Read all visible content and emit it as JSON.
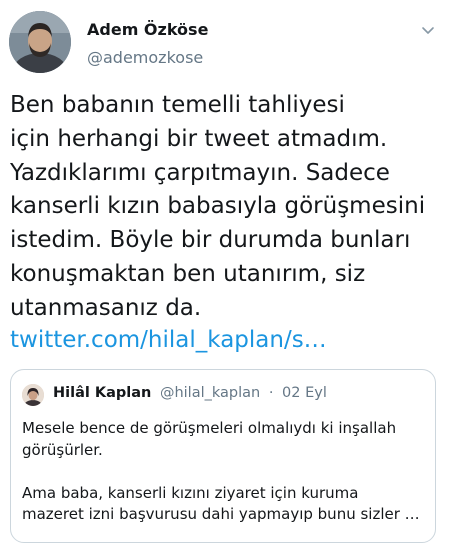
{
  "author": {
    "name": "Adem Özköse",
    "handle": "@ademozkose"
  },
  "icons": {
    "avatar": "person-avatar",
    "menu": "chevron-down-icon"
  },
  "tweet": {
    "lines": [
      "Ben babanın temelli tahliyesi",
      "için herhangi bir tweet atmadım.",
      "Yazdıklarımı çarpıtmayın. Sadece",
      "kanserli kızın babasıyla görüşmesini",
      "istedim. Böyle bir durumda bunları",
      "konuşmaktan ben utanırım, siz",
      "utanmasanız da."
    ],
    "link": "twitter.com/hilal_kaplan/s…"
  },
  "quote": {
    "name": "Hilâl Kaplan",
    "handle": "@hilal_kaplan",
    "separator": "·",
    "date": "02 Eyl",
    "paragraph1": [
      "Mesele bence de görüşmeleri olmalıydı ki inşallah",
      "görüşürler."
    ],
    "paragraph2": [
      "Ama baba, kanserli kızını ziyaret için  kuruma",
      "mazeret izni başvurusu dahi yapmayıp bunu sizler …"
    ]
  },
  "colors": {
    "text": "#14171a",
    "secondary": "#657786",
    "link": "#1b95e0",
    "border": "#ccd6dd"
  }
}
